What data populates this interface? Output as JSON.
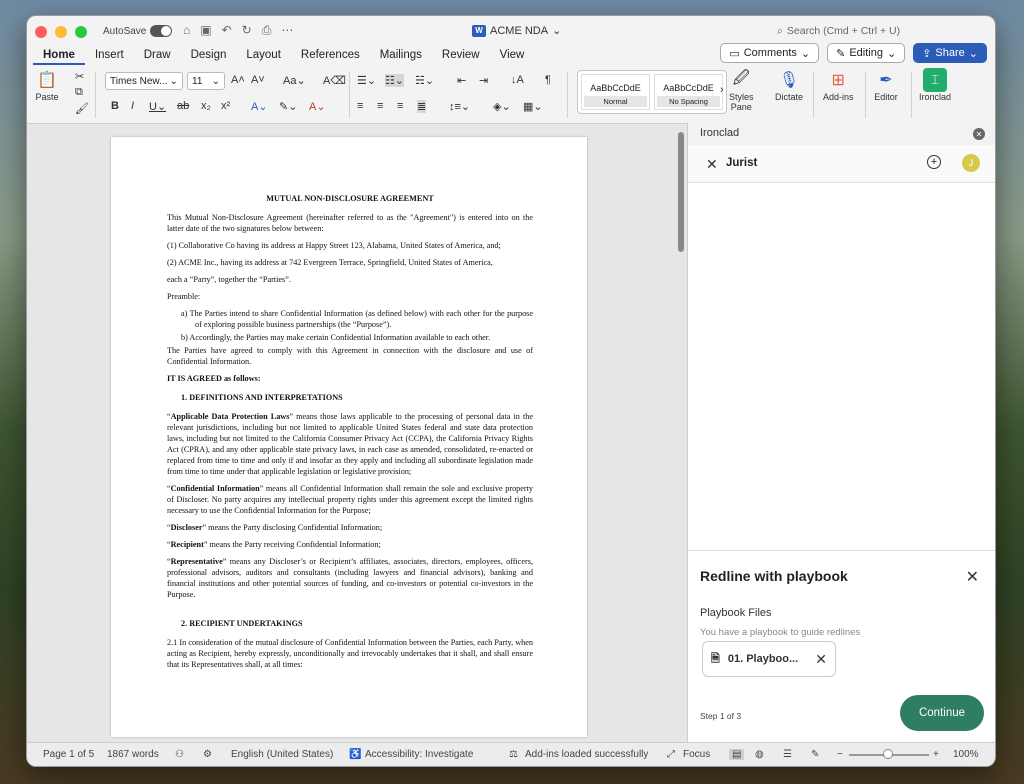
{
  "titlebar": {
    "autosave": "AutoSave",
    "doc_title": "ACME NDA",
    "search": "Search (Cmd + Ctrl + U)",
    "doc_badge": "W"
  },
  "tabs": [
    "Home",
    "Insert",
    "Draw",
    "Design",
    "Layout",
    "References",
    "Mailings",
    "Review",
    "View"
  ],
  "tab_actions": {
    "comments": "Comments",
    "editing": "Editing",
    "share": "Share"
  },
  "ribbon": {
    "paste": "Paste",
    "font_name": "Times New...",
    "font_size": "11",
    "styles": [
      {
        "sample": "AaBbCcDdE",
        "name": "Normal"
      },
      {
        "sample": "AaBbCcDdE",
        "name": "No Spacing"
      }
    ],
    "styles_pane": "Styles\nPane",
    "styles_pane_l1": "Styles",
    "styles_pane_l2": "Pane",
    "dictate": "Dictate",
    "addins": "Add-ins",
    "editor": "Editor",
    "ironclad": "Ironclad"
  },
  "document": {
    "title": "MUTUAL NON-DISCLOSURE AGREEMENT",
    "intro": "This Mutual Non-Disclosure Agreement (hereinafter referred to as the \"Agreement\") is entered into on the latter date of the two signatures below between:",
    "party1": "(1) Collaborative Co having its address at Happy Street 123, Alabama, United States of America, and;",
    "party2": "(2) ACME Inc., having its address at 742 Evergreen Terrace, Springfield, United States of America,",
    "parties": "each a “Party”, together the “Parties”.",
    "preamble": "Preamble:",
    "pre_a": "a)  The Parties intend to share Confidential Information (as defined below) with each other for the purpose of exploring possible business partnerships (the “Purpose”).",
    "pre_b": "b)  Accordingly, the Parties may make certain Confidential Information available to each other.",
    "agreed_comply": "The Parties have agreed to comply with this Agreement in connection with the disclosure and use of Confidential Information.",
    "agreed": "IT IS AGREED as follows:",
    "h1": "1.    DEFINITIONS AND INTERPRETATIONS",
    "def1_term": "Applicable Data Protection Laws",
    "def1_text": "” means those laws applicable to the processing of personal data in the relevant jurisdictions, including but not limited to applicable United States federal and state data protection laws, including but not limited to the California Consumer Privacy Act (CCPA), the California Privacy Rights Act (CPRA), and any other applicable state privacy laws, in each case as amended, consolidated, re-enacted or replaced from time to time and only if and insofar as they apply and including all subordinate legislation made from time to time under that applicable legislation or legislative provision;",
    "def2_term": "Confidential Information",
    "def2_text": "” means all Confidential Information shall remain the sole and exclusive property of Discloser. No party acquires any intellectual property rights under this agreement except the limited rights necessary to use the Confidential Information for the Purpose;",
    "def3_term": "Discloser",
    "def3_text": "” means the Party disclosing Confidential Information;",
    "def4_term": "Recipient",
    "def4_text": "” means the Party receiving Confidential Information;",
    "def5_term": "Representative",
    "def5_text": "” means any Discloser’s or Recipient’s affiliates, associates, directors, employees, officers, professional advisors, auditors and consultants (including lawyers and financial advisors), banking and financial institutions and other potential sources of funding, and co-investors or potential co-investors in the Purpose.",
    "h2": "2.    RECIPIENT UNDERTAKINGS",
    "p21": "2.1 In consideration of the mutual disclosure of Confidential Information between the Parties, each Party, when acting as Recipient, hereby expressly, unconditionally and irrevocably undertakes that it shall, and shall ensure that its Representatives shall, at all times:"
  },
  "panel": {
    "title": "Ironclad",
    "jurist": "Jurist",
    "avatar": "J",
    "redline_title": "Redline with playbook",
    "playbook_files": "Playbook Files",
    "hint": "You have a playbook to guide redlines",
    "file_name": "01. Playboo...",
    "step": "Step 1 of 3",
    "continue": "Continue"
  },
  "status": {
    "page": "Page 1 of 5",
    "words": "1867 words",
    "language": "English (United States)",
    "accessibility": "Accessibility: Investigate",
    "addins": "Add-ins loaded successfully",
    "focus": "Focus",
    "zoom": "100%"
  },
  "colors": {
    "accent": "#2b5cb8",
    "continue": "#2e7d64",
    "avatar": "#d9c94a"
  }
}
